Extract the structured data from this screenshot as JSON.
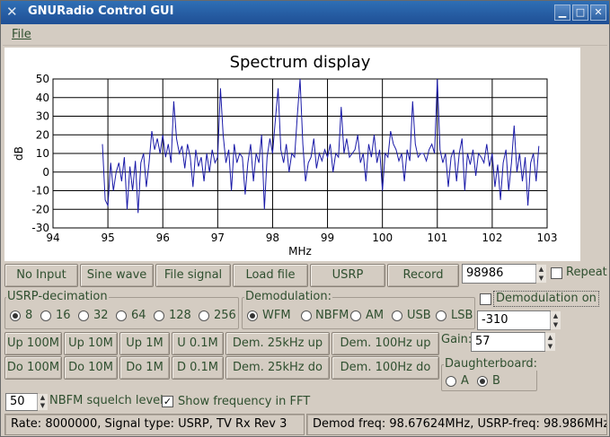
{
  "window": {
    "title": "GNURadio Control GUI",
    "title_icon": "x-tools-icon",
    "minimize": "▁",
    "maximize": "□",
    "close": "✕"
  },
  "menu": {
    "file_label": "File"
  },
  "chart_data": {
    "type": "line",
    "title": "Spectrum display",
    "xlabel": "MHz",
    "ylabel": "dB",
    "xlim": [
      94,
      103
    ],
    "ylim": [
      -30,
      50
    ],
    "xticks": [
      "94",
      "95",
      "96",
      "97",
      "98",
      "99",
      "100",
      "101",
      "102",
      "103"
    ],
    "yticks": [
      "-30",
      "-20",
      "-10",
      "0",
      "10",
      "20",
      "30",
      "40",
      "50"
    ],
    "grid": true,
    "color": "#1a1aa8",
    "x": [
      94.9,
      94.95,
      95.0,
      95.05,
      95.1,
      95.15,
      95.2,
      95.25,
      95.3,
      95.35,
      95.4,
      95.45,
      95.5,
      95.55,
      95.6,
      95.65,
      95.7,
      95.75,
      95.8,
      95.85,
      95.9,
      95.95,
      96.0,
      96.05,
      96.1,
      96.15,
      96.2,
      96.25,
      96.3,
      96.35,
      96.4,
      96.45,
      96.5,
      96.55,
      96.6,
      96.65,
      96.7,
      96.75,
      96.8,
      96.85,
      96.9,
      96.95,
      97.0,
      97.05,
      97.1,
      97.15,
      97.2,
      97.25,
      97.3,
      97.35,
      97.4,
      97.45,
      97.5,
      97.55,
      97.6,
      97.65,
      97.7,
      97.75,
      97.8,
      97.85,
      97.9,
      97.95,
      98.0,
      98.05,
      98.1,
      98.15,
      98.2,
      98.25,
      98.3,
      98.35,
      98.4,
      98.45,
      98.5,
      98.55,
      98.6,
      98.65,
      98.7,
      98.75,
      98.8,
      98.85,
      98.9,
      98.95,
      99.0,
      99.05,
      99.1,
      99.15,
      99.2,
      99.25,
      99.3,
      99.35,
      99.4,
      99.45,
      99.5,
      99.55,
      99.6,
      99.65,
      99.7,
      99.75,
      99.8,
      99.85,
      99.9,
      99.95,
      100.0,
      100.05,
      100.1,
      100.15,
      100.2,
      100.25,
      100.3,
      100.35,
      100.4,
      100.45,
      100.5,
      100.55,
      100.6,
      100.65,
      100.7,
      100.75,
      100.8,
      100.85,
      100.9,
      100.95,
      101.0,
      101.05,
      101.1,
      101.15,
      101.2,
      101.25,
      101.3,
      101.35,
      101.4,
      101.45,
      101.5,
      101.55,
      101.6,
      101.65,
      101.7,
      101.75,
      101.8,
      101.85,
      101.9,
      101.95,
      102.0,
      102.05,
      102.1,
      102.15,
      102.2,
      102.25,
      102.3,
      102.35,
      102.4,
      102.45,
      102.5,
      102.55,
      102.6,
      102.65,
      102.7,
      102.75,
      102.8,
      102.85
    ],
    "y": [
      15,
      -15,
      -18,
      5,
      -10,
      0,
      5,
      -5,
      8,
      -20,
      3,
      -10,
      6,
      -22,
      5,
      10,
      -8,
      5,
      22,
      12,
      18,
      10,
      20,
      8,
      15,
      5,
      38,
      18,
      10,
      14,
      2,
      15,
      8,
      -8,
      12,
      3,
      8,
      -5,
      10,
      0,
      12,
      5,
      8,
      45,
      20,
      5,
      12,
      -10,
      15,
      5,
      10,
      8,
      -12,
      5,
      15,
      -5,
      10,
      5,
      20,
      -20,
      8,
      18,
      10,
      28,
      45,
      12,
      5,
      15,
      0,
      10,
      8,
      30,
      50,
      15,
      -5,
      5,
      8,
      18,
      2,
      10,
      6,
      12,
      8,
      15,
      0,
      10,
      8,
      35,
      10,
      18,
      8,
      10,
      12,
      20,
      5,
      10,
      -5,
      15,
      8,
      20,
      5,
      12,
      -10,
      10,
      8,
      22,
      15,
      12,
      6,
      10,
      -5,
      12,
      6,
      38,
      15,
      8,
      10,
      10,
      6,
      12,
      15,
      10,
      50,
      12,
      5,
      10,
      -8,
      8,
      12,
      -5,
      10,
      18,
      -10,
      10,
      4,
      12,
      -2,
      10,
      8,
      5,
      15,
      3,
      10,
      -8,
      4,
      -15,
      5,
      12,
      -10,
      5,
      25,
      0,
      10,
      -5,
      8,
      -18,
      5,
      10,
      -5,
      14,
      5
    ]
  },
  "buttons_row1": [
    "No Input",
    "Sine wave",
    "File signal",
    "Load file",
    "USRP",
    "Record"
  ],
  "freq_value": "98986",
  "repeat_label": "Repeat",
  "decimation": {
    "label": "USRP-decimation",
    "options": [
      "8",
      "16",
      "32",
      "64",
      "128",
      "256"
    ],
    "selected": "8"
  },
  "demodulation": {
    "label": "Demodulation:",
    "options": [
      "WFM",
      "NBFM",
      "AM",
      "USB",
      "LSB"
    ],
    "selected": "WFM"
  },
  "demod_on_label": "Demodulation on",
  "offset_value": "-310",
  "tune_up": [
    "Up 100M",
    "Up 10M",
    "Up 1M",
    "U 0.1M",
    "Dem. 25kHz up",
    "Dem. 100Hz up"
  ],
  "tune_down": [
    "Do 100M",
    "Do 10M",
    "Do 1M",
    "D 0.1M",
    "Dem. 25kHz do",
    "Dem. 100Hz do"
  ],
  "gain": {
    "label": "Gain:",
    "value": "57"
  },
  "daughterboard": {
    "label": "Daughterboard:",
    "options": [
      "A",
      "B"
    ],
    "selected": "B"
  },
  "squelch": {
    "value": "50",
    "label": "NBFM squelch level"
  },
  "show_freq": {
    "label": "Show frequency in FFT",
    "checked": true
  },
  "status": {
    "left": "Rate: 8000000,  Signal type: USRP, TV Rx Rev 3",
    "right": "Demod freq: 98.67624MHz,  USRP-freq: 98.986MHz"
  }
}
